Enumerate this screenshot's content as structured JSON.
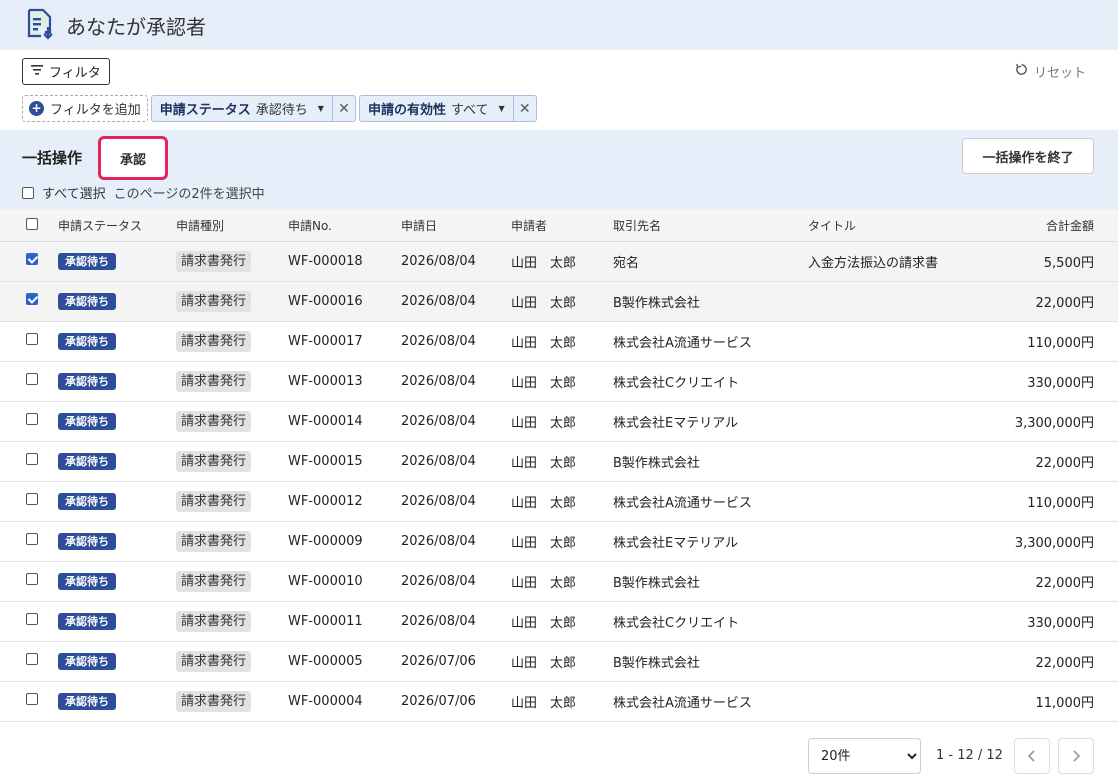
{
  "header": {
    "title": "あなたが承認者",
    "icon": "document-arrow-icon"
  },
  "filters": {
    "filter_button_label": "フィルタ",
    "reset_label": "リセット",
    "add_filter_label": "フィルタを追加",
    "chips": [
      {
        "label": "申請ステータス",
        "value": "承認待ち"
      },
      {
        "label": "申請の有効性",
        "value": "すべて"
      }
    ]
  },
  "bulk": {
    "title": "一括操作",
    "approve_label": "承認",
    "end_label": "一括操作を終了",
    "select_all_label": "すべて選択",
    "selection_note": "このページの2件を選択中"
  },
  "table": {
    "columns": [
      "申請ステータス",
      "申請種別",
      "申請No.",
      "申請日",
      "申請者",
      "取引先名",
      "タイトル",
      "合計金額"
    ],
    "rows": [
      {
        "checked": true,
        "status": "承認待ち",
        "type": "請求書発行",
        "no": "WF-000018",
        "date": "2026/08/04",
        "applicant": "山田　太郎",
        "partner": "宛名",
        "title": "入金方法振込の請求書",
        "amount": "5,500円"
      },
      {
        "checked": true,
        "status": "承認待ち",
        "type": "請求書発行",
        "no": "WF-000016",
        "date": "2026/08/04",
        "applicant": "山田　太郎",
        "partner": "B製作株式会社",
        "title": "",
        "amount": "22,000円"
      },
      {
        "checked": false,
        "status": "承認待ち",
        "type": "請求書発行",
        "no": "WF-000017",
        "date": "2026/08/04",
        "applicant": "山田　太郎",
        "partner": "株式会社A流通サービス",
        "title": "",
        "amount": "110,000円"
      },
      {
        "checked": false,
        "status": "承認待ち",
        "type": "請求書発行",
        "no": "WF-000013",
        "date": "2026/08/04",
        "applicant": "山田　太郎",
        "partner": "株式会社Cクリエイト",
        "title": "",
        "amount": "330,000円"
      },
      {
        "checked": false,
        "status": "承認待ち",
        "type": "請求書発行",
        "no": "WF-000014",
        "date": "2026/08/04",
        "applicant": "山田　太郎",
        "partner": "株式会社Eマテリアル",
        "title": "",
        "amount": "3,300,000円"
      },
      {
        "checked": false,
        "status": "承認待ち",
        "type": "請求書発行",
        "no": "WF-000015",
        "date": "2026/08/04",
        "applicant": "山田　太郎",
        "partner": "B製作株式会社",
        "title": "",
        "amount": "22,000円"
      },
      {
        "checked": false,
        "status": "承認待ち",
        "type": "請求書発行",
        "no": "WF-000012",
        "date": "2026/08/04",
        "applicant": "山田　太郎",
        "partner": "株式会社A流通サービス",
        "title": "",
        "amount": "110,000円"
      },
      {
        "checked": false,
        "status": "承認待ち",
        "type": "請求書発行",
        "no": "WF-000009",
        "date": "2026/08/04",
        "applicant": "山田　太郎",
        "partner": "株式会社Eマテリアル",
        "title": "",
        "amount": "3,300,000円"
      },
      {
        "checked": false,
        "status": "承認待ち",
        "type": "請求書発行",
        "no": "WF-000010",
        "date": "2026/08/04",
        "applicant": "山田　太郎",
        "partner": "B製作株式会社",
        "title": "",
        "amount": "22,000円"
      },
      {
        "checked": false,
        "status": "承認待ち",
        "type": "請求書発行",
        "no": "WF-000011",
        "date": "2026/08/04",
        "applicant": "山田　太郎",
        "partner": "株式会社Cクリエイト",
        "title": "",
        "amount": "330,000円"
      },
      {
        "checked": false,
        "status": "承認待ち",
        "type": "請求書発行",
        "no": "WF-000005",
        "date": "2026/07/06",
        "applicant": "山田　太郎",
        "partner": "B製作株式会社",
        "title": "",
        "amount": "22,000円"
      },
      {
        "checked": false,
        "status": "承認待ち",
        "type": "請求書発行",
        "no": "WF-000004",
        "date": "2026/07/06",
        "applicant": "山田　太郎",
        "partner": "株式会社A流通サービス",
        "title": "",
        "amount": "11,000円"
      }
    ]
  },
  "pager": {
    "per_page": "20件",
    "range": "1 - 12 / 12"
  },
  "colors": {
    "accent": "#2e4d9a",
    "highlight": "#e5245e",
    "band": "#e6eef9"
  }
}
